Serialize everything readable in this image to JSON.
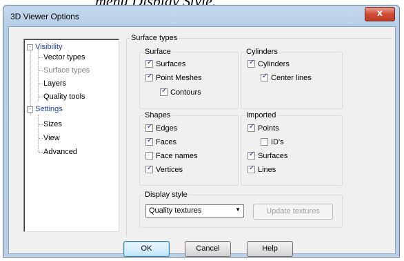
{
  "caption": "menu Display Style.",
  "window": {
    "title": "3D Viewer Options",
    "close_glyph": "x"
  },
  "tree": {
    "visibility": "Visibility",
    "vector_types": "Vector types",
    "surface_types": "Surface types",
    "layers": "Layers",
    "quality_tools": "Quality tools",
    "settings": "Settings",
    "sizes": "Sizes",
    "view": "View",
    "advanced": "Advanced",
    "collapse_glyph": "-"
  },
  "panel": {
    "title": "Surface types",
    "surface": {
      "label": "Surface",
      "surfaces": "Surfaces",
      "point_meshes": "Point Meshes",
      "contours": "Contours"
    },
    "cylinders": {
      "label": "Cylinders",
      "cylinders": "Cylinders",
      "center_lines": "Center lines"
    },
    "shapes": {
      "label": "Shapes",
      "edges": "Edges",
      "faces": "Faces",
      "face_names": "Face names",
      "vertices": "Vertices"
    },
    "imported": {
      "label": "Imported",
      "points": "Points",
      "ids": "ID's",
      "surfaces": "Surfaces",
      "lines": "Lines"
    },
    "display_style": {
      "label": "Display style",
      "selected": "Quality textures",
      "update_button": "Update textures"
    }
  },
  "checked": {
    "surfaces": true,
    "point_meshes": true,
    "contours": true,
    "cylinders": true,
    "center_lines": true,
    "edges": true,
    "faces": true,
    "face_names": false,
    "vertices": true,
    "points": true,
    "ids": false,
    "imported_surfaces": true,
    "lines": true
  },
  "buttons": {
    "ok": "OK",
    "cancel": "Cancel",
    "help": "Help"
  }
}
